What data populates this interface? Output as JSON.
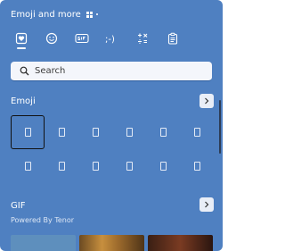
{
  "header": {
    "title": "Emoji and more"
  },
  "tabs": [
    {
      "icon": "heart-icon",
      "active": true
    },
    {
      "icon": "smiley-icon",
      "active": false
    },
    {
      "icon": "gif-icon",
      "active": false
    },
    {
      "icon": "kaomoji-icon",
      "label": ";-)",
      "active": false
    },
    {
      "icon": "symbols-icon",
      "active": false
    },
    {
      "icon": "clipboard-icon",
      "active": false
    }
  ],
  "search": {
    "placeholder": "Search",
    "value": ""
  },
  "emoji_section": {
    "title": "Emoji",
    "cells": 12,
    "selected_index": 0
  },
  "gif_section": {
    "title": "GIF",
    "subtitle": "Powered By Tenor"
  },
  "colors": {
    "panel": "#4f80c1",
    "search_bg": "#f4f6fb",
    "arrow_bg": "#e9eef7",
    "selection_border": "#111111"
  }
}
